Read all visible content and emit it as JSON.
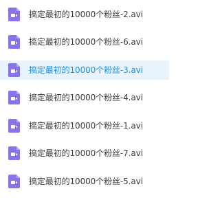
{
  "files": [
    {
      "name": "搞定最初的10000个粉丝-2.avi",
      "icon": "video-file-icon",
      "selected": false
    },
    {
      "name": "搞定最初的10000个粉丝-6.avi",
      "icon": "video-file-icon",
      "selected": false
    },
    {
      "name": "搞定最初的10000个粉丝-3.avi",
      "icon": "video-file-icon",
      "selected": true
    },
    {
      "name": "搞定最初的10000个粉丝-4.avi",
      "icon": "video-file-icon",
      "selected": false
    },
    {
      "name": "搞定最初的10000个粉丝-1.avi",
      "icon": "video-file-icon",
      "selected": false
    },
    {
      "name": "搞定最初的10000个粉丝-7.avi",
      "icon": "video-file-icon",
      "selected": false
    },
    {
      "name": "搞定最初的10000个粉丝-5.avi",
      "icon": "video-file-icon",
      "selected": false
    }
  ],
  "colors": {
    "icon": "#8a72e8",
    "icon_fold": "#b9a9f3",
    "text": "#3b3b3b",
    "selected_text": "#1a8ee6",
    "selected_bg": "#e8f4fd"
  }
}
